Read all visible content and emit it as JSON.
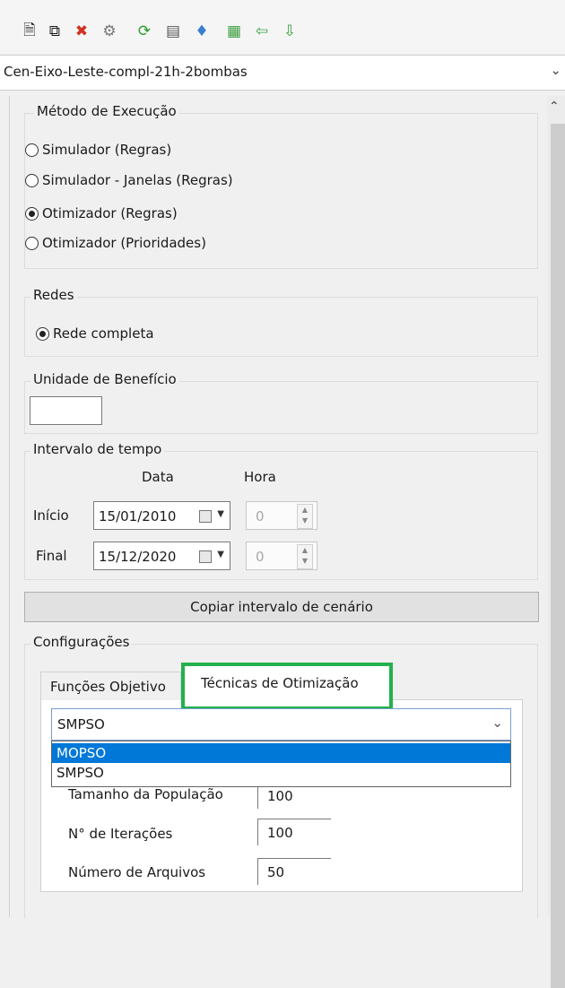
{
  "toolbar": {
    "icons": [
      "new-file-icon",
      "copy-file-icon",
      "delete-file-icon",
      "settings-icon",
      "refresh-icon",
      "list-icon",
      "tag-icon",
      "export-icon",
      "import-icon",
      "download-icon"
    ]
  },
  "scenario": {
    "value": "Cen-Eixo-Leste-compl-21h-2bombas"
  },
  "metodo": {
    "legend": "Método de Execução",
    "options": [
      "Simulador (Regras)",
      "Simulador - Janelas (Regras)",
      "Otimizador (Regras)",
      "Otimizador (Prioridades)"
    ],
    "selected_index": 2
  },
  "redes": {
    "legend": "Redes",
    "option": "Rede completa"
  },
  "unidade": {
    "legend": "Unidade de Benefício",
    "value": ""
  },
  "intervalo": {
    "legend": "Intervalo de tempo",
    "col_data": "Data",
    "col_hora": "Hora",
    "inicio_label": "Início",
    "inicio_date": "15/01/2010",
    "inicio_hora": "0",
    "final_label": "Final",
    "final_date": "15/12/2020",
    "final_hora": "0"
  },
  "copy_button": "Copiar intervalo de cenário",
  "configuracoes": {
    "legend": "Configurações",
    "tabs": [
      "Funções Objetivo",
      "Técnicas de Otimização"
    ],
    "active_tab": 1,
    "algorithm_selected": "SMPSO",
    "algorithm_options": [
      "MOPSO",
      "SMPSO"
    ],
    "highlighted_option": 0,
    "fields": [
      {
        "label": "Tamanho da População",
        "value": "100"
      },
      {
        "label": "N° de Iterações",
        "value": "100"
      },
      {
        "label": "Número de Arquivos",
        "value": "50"
      }
    ]
  },
  "colors": {
    "accent": "#0078d7",
    "highlight_border": "#22b14c"
  }
}
